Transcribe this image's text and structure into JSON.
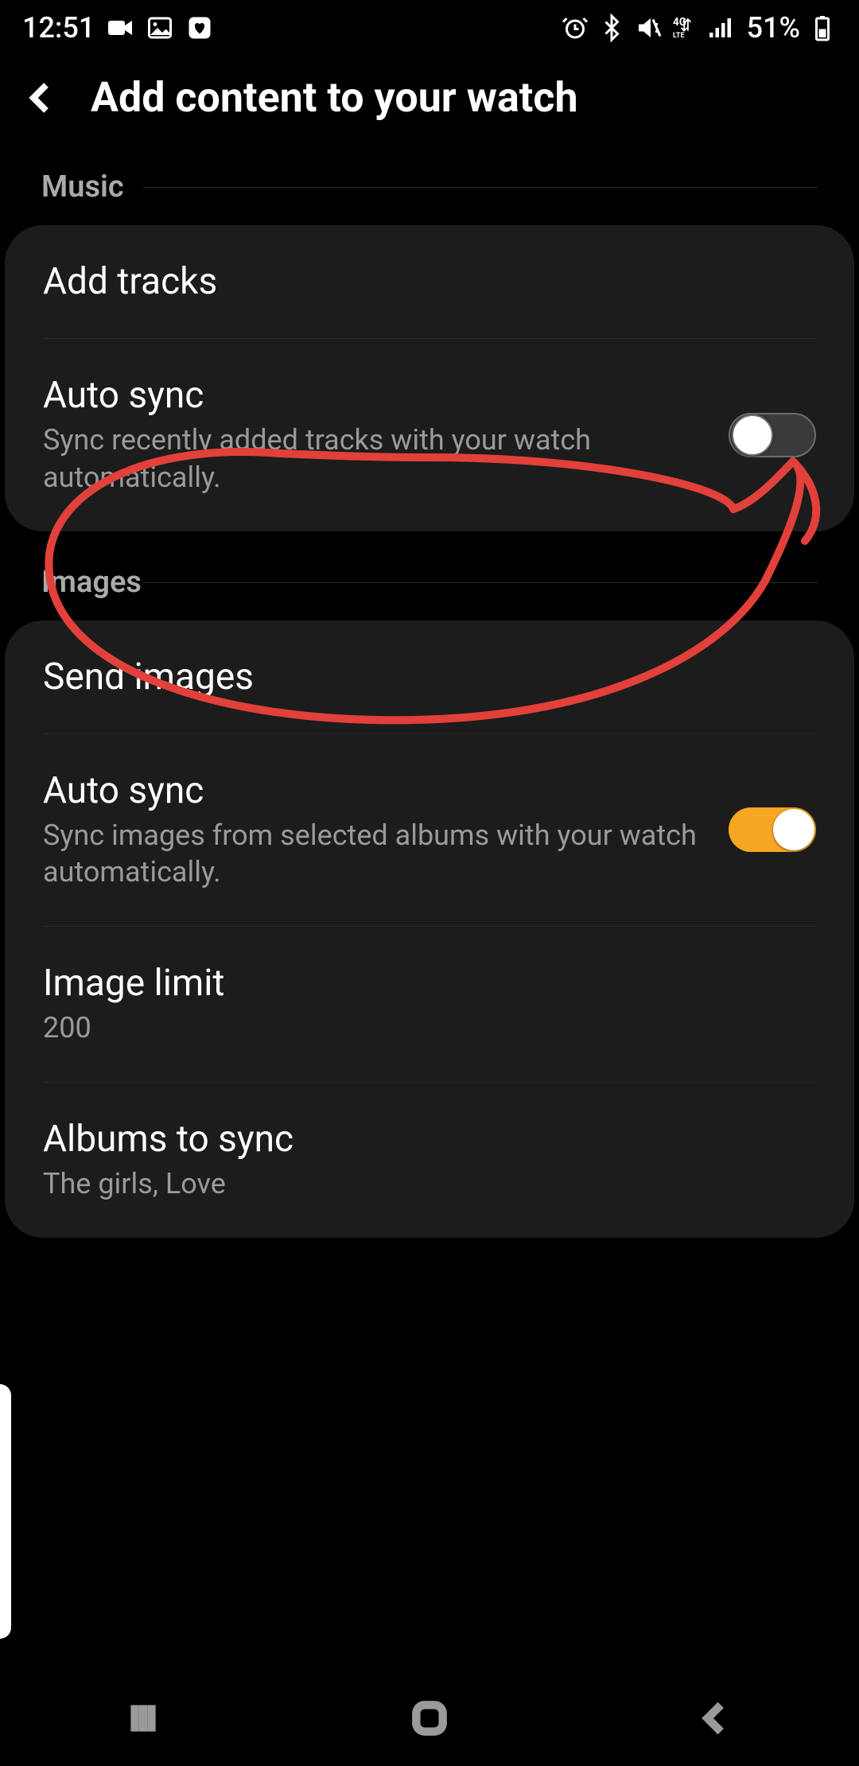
{
  "status": {
    "time": "12:51",
    "battery_text": "51%"
  },
  "header": {
    "title": "Add content to your watch"
  },
  "sections": {
    "music_label": "Music",
    "images_label": "Images"
  },
  "music": {
    "add_tracks": "Add tracks",
    "auto_sync_title": "Auto sync",
    "auto_sync_sub": "Sync recently added tracks with your watch automatically.",
    "auto_sync_on": false
  },
  "images": {
    "send_images": "Send images",
    "auto_sync_title": "Auto sync",
    "auto_sync_sub": "Sync images from selected albums with your watch automatically.",
    "auto_sync_on": true,
    "image_limit_title": "Image limit",
    "image_limit_value": "200",
    "albums_title": "Albums to sync",
    "albums_value": "The girls, Love"
  },
  "annotation_color": "#e2403a"
}
